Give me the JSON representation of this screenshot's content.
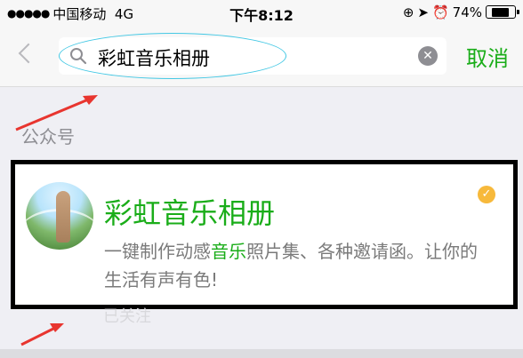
{
  "status_bar": {
    "signal_dots": "●●●●●",
    "carrier": "中国移动",
    "network": "4G",
    "time": "下午8:12",
    "lock_rotation_icon": "⊕",
    "location_icon": "➤",
    "alarm_icon": "⏰",
    "battery_percent": "74%",
    "battery_level": 0.74
  },
  "search": {
    "query": "彩虹音乐相册",
    "cancel_label": "取消"
  },
  "results": {
    "section_label": "公众号",
    "account": {
      "name": "彩虹音乐相册",
      "desc_before": "一键制作动感",
      "desc_keyword": "音乐",
      "desc_after": "照片集、各种邀请函。让你的生活有声有色!",
      "followed_label": "已关注"
    }
  },
  "colors": {
    "accent_green": "#1aad19",
    "annotation_red": "#e8352f",
    "annotation_cyan": "#44c8e4",
    "verified_badge": "#f7b93b"
  }
}
